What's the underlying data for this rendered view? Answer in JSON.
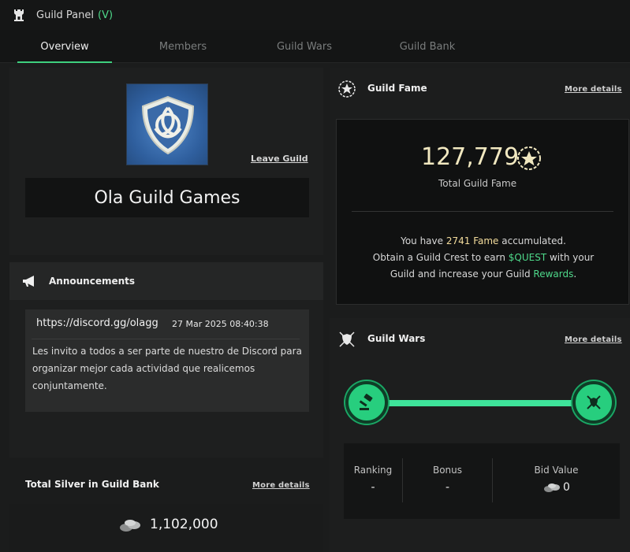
{
  "window": {
    "title": "Guild Panel",
    "version": "(V)"
  },
  "tabs": [
    {
      "label": "Overview",
      "active": true
    },
    {
      "label": "Members",
      "active": false
    },
    {
      "label": "Guild Wars",
      "active": false
    },
    {
      "label": "Guild Bank",
      "active": false
    }
  ],
  "guild": {
    "name": "Ola Guild Games",
    "leave_label": "Leave Guild",
    "emblem_icon": "triquetra-shield-icon"
  },
  "announcements": {
    "title": "Announcements",
    "icon": "megaphone-icon",
    "items": [
      {
        "link": "https://discord.gg/olagg",
        "date": "27 Mar 2025 08:40:38",
        "text": "Les invito a todos a ser parte de nuestro de Discord para organizar mejor cada actividad que realicemos conjuntamente."
      }
    ]
  },
  "silver": {
    "title": "Total Silver in Guild Bank",
    "more_label": "More details",
    "value": "1,102,000",
    "icon": "silver-coins-icon"
  },
  "fame": {
    "title": "Guild Fame",
    "more_label": "More details",
    "total": "127,779",
    "total_label": "Total Guild Fame",
    "icon": "star-badge-icon",
    "line1_pre": "You have ",
    "line1_amount": "2741 Fame",
    "line1_post": " accumulated.",
    "line2_pre": "Obtain a Guild Crest to earn ",
    "line2_token": "$QUEST",
    "line2_post": " with your",
    "line3_pre": "Guild and increase your Guild ",
    "line3_link": "Rewards",
    "line3_post": "."
  },
  "wars": {
    "title": "Guild Wars",
    "more_label": "More details",
    "icon": "shield-swords-icon",
    "start_icon": "gavel-icon",
    "end_icon": "shield-swords-icon",
    "stats": [
      {
        "label": "Ranking",
        "value": "-"
      },
      {
        "label": "Bonus",
        "value": "-"
      },
      {
        "label": "Bid Value",
        "value": "0"
      }
    ]
  },
  "colors": {
    "accent": "#3ecf7e",
    "gold": "#f3dc9c",
    "background": "#1b1c1c"
  }
}
